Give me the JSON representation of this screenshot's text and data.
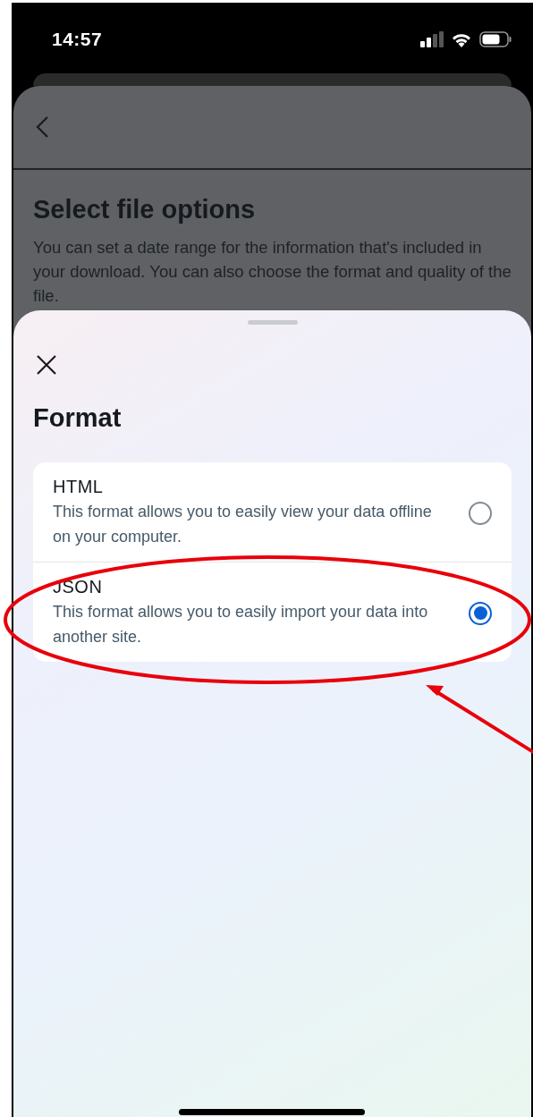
{
  "status_bar": {
    "time": "14:57"
  },
  "page": {
    "title": "Select file options",
    "description": "You can set a date range for the information that's included in your download. You can also choose the format and quality of the file."
  },
  "sheet": {
    "title": "Format",
    "options": [
      {
        "label": "HTML",
        "description": "This format allows you to easily view your data offline on your computer.",
        "selected": false
      },
      {
        "label": "JSON",
        "description": "This format allows you to easily import your data into another site.",
        "selected": true
      }
    ]
  }
}
